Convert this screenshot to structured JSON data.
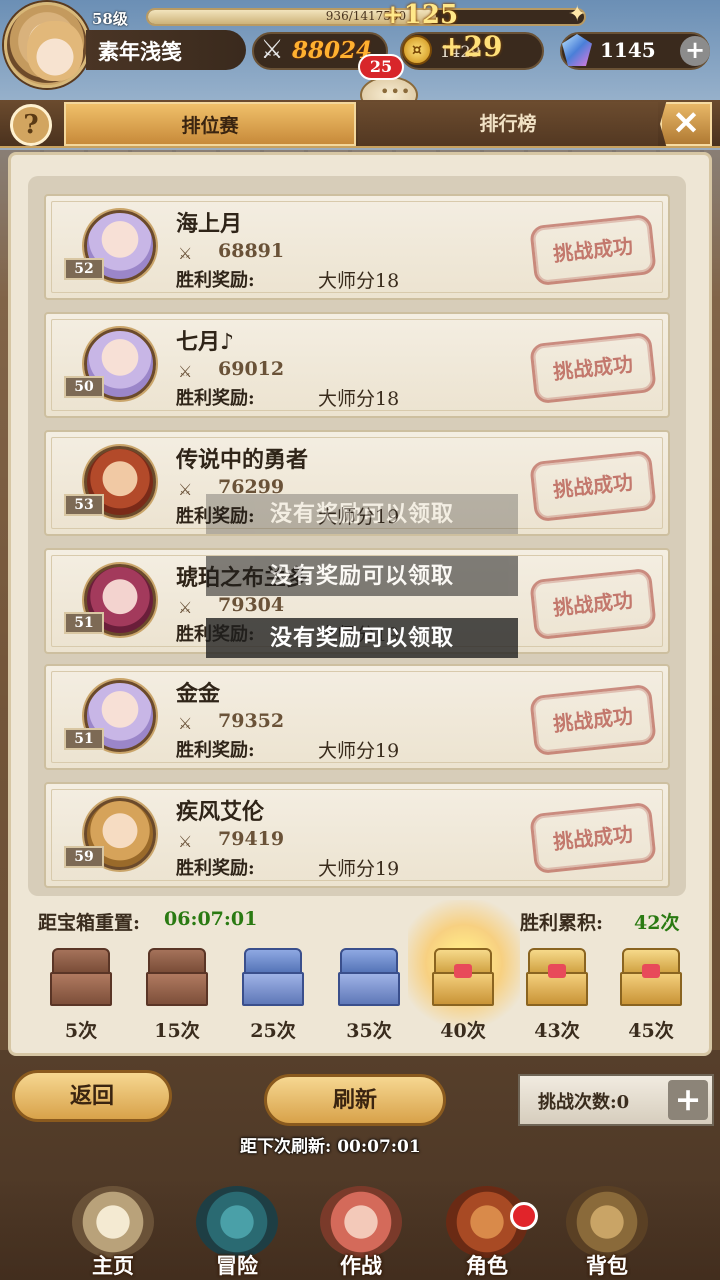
{
  "player": {
    "level": "58级",
    "name": "素年浅笺",
    "xp_text": "936/1417500",
    "xp_gain": "+125",
    "xp_fraction": 0.66,
    "power": "88024",
    "gold": "1429",
    "gold_gain": "+29",
    "gems": "1145",
    "chat_badge": "25"
  },
  "tabs": [
    "排位赛",
    "排行榜"
  ],
  "reward_label": "胜利奖励:",
  "stamp_text": "挑战成功",
  "opponents": [
    {
      "name": "海上月",
      "level": "52",
      "power": "68891",
      "reward": "大师分18"
    },
    {
      "name": "七月♪",
      "level": "50",
      "power": "69012",
      "reward": "大师分18"
    },
    {
      "name": "传说中的勇者",
      "level": "53",
      "power": "76299",
      "reward": "大师分19"
    },
    {
      "name": "琥珀之布兰多",
      "level": "51",
      "power": "79304",
      "reward": "大师分19"
    },
    {
      "name": "金金",
      "level": "51",
      "power": "79352",
      "reward": "大师分19"
    },
    {
      "name": "疾风艾伦",
      "level": "59",
      "power": "79419",
      "reward": "大师分19"
    }
  ],
  "toasts": [
    "没有奖励可以领取",
    "没有奖励可以领取",
    "没有奖励可以领取"
  ],
  "chest_area": {
    "reset_label": "距宝箱重置:",
    "reset_time": "06:07:01",
    "wins_label": "胜利累积:",
    "wins_value": "42次",
    "chests": [
      {
        "label": "5次",
        "state": "opened"
      },
      {
        "label": "15次",
        "state": "opened"
      },
      {
        "label": "25次",
        "state": "blue"
      },
      {
        "label": "35次",
        "state": "blue"
      },
      {
        "label": "40次",
        "state": "gold-glow"
      },
      {
        "label": "43次",
        "state": "gold"
      },
      {
        "label": "45次",
        "state": "gold"
      }
    ]
  },
  "buttons": {
    "back": "返回",
    "refresh": "刷新",
    "refresh_timer": "距下次刷新: 00:07:01",
    "challenges": "挑战次数:0"
  },
  "nav": [
    "主页",
    "冒险",
    "作战",
    "角色",
    "背包"
  ]
}
